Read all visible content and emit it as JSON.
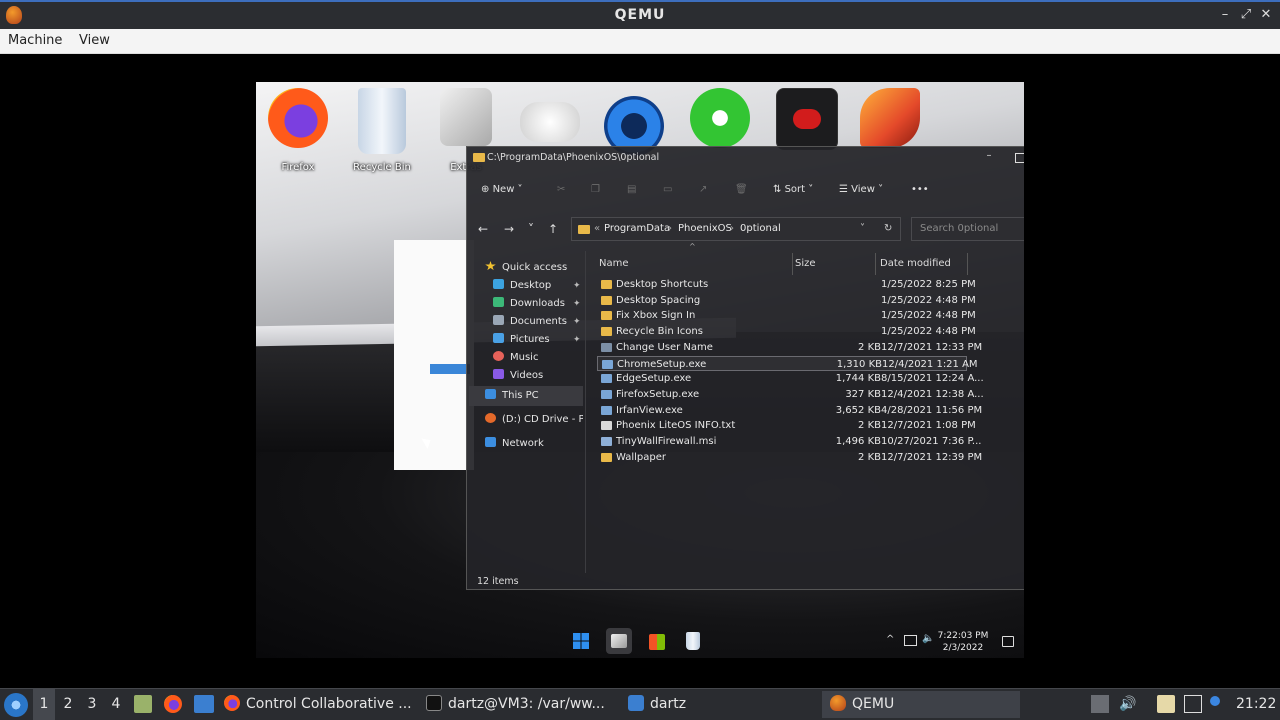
{
  "qemu": {
    "title": "QEMU",
    "menu": [
      "Machine",
      "View"
    ],
    "controls": {
      "minimize": "–",
      "restore": "⤢",
      "close": "✕"
    }
  },
  "desktop_icons": [
    {
      "label": "Firefox",
      "icon": "firefox-icon",
      "color": "#ff7a1a"
    },
    {
      "label": "Recycle Bin",
      "icon": "recycle-bin-icon",
      "color": "#9db7d6"
    },
    {
      "label": "Extras",
      "icon": "folder-stack-icon",
      "color": "#c9c9c9"
    },
    {
      "label": "",
      "icon": "gamepad-icon",
      "color": "#e9e9e9"
    },
    {
      "label": "",
      "icon": "power-ring-icon",
      "color": "#1f6fd1"
    },
    {
      "label": "",
      "icon": "xbox-icon",
      "color": "#2fbf2f"
    },
    {
      "label": "",
      "icon": "youtube-icon",
      "color": "#d21c1c"
    },
    {
      "label": "",
      "icon": "phoenix-icon",
      "color": "#e4492a"
    }
  ],
  "explorer": {
    "title": "C:\\ProgramData\\PhoenixOS\\0ptional",
    "toolbar": {
      "new": "New",
      "sort": "Sort",
      "view": "View",
      "more": "•••"
    },
    "breadcrumb": [
      "ProgramData",
      "PhoenixOS",
      "0ptional"
    ],
    "search_placeholder": "Search 0ptional",
    "nav": {
      "quick_access": "Quick access",
      "desktop": "Desktop",
      "downloads": "Downloads",
      "documents": "Documents",
      "pictures": "Pictures",
      "music": "Music",
      "videos": "Videos",
      "this_pc": "This PC",
      "cd_drive": "(D:) CD Drive - Phoenix",
      "network": "Network"
    },
    "columns": {
      "name": "Name",
      "size": "Size",
      "date": "Date modified"
    },
    "files": [
      {
        "name": "Desktop Shortcuts",
        "size": "",
        "date": "1/25/2022 8:25 PM",
        "type": "folder"
      },
      {
        "name": "Desktop Spacing",
        "size": "",
        "date": "1/25/2022 4:48 PM",
        "type": "folder"
      },
      {
        "name": "Fix Xbox Sign In",
        "size": "",
        "date": "1/25/2022 4:48 PM",
        "type": "folder"
      },
      {
        "name": "Recycle Bin Icons",
        "size": "",
        "date": "1/25/2022 4:48 PM",
        "type": "folder"
      },
      {
        "name": "Change User Name",
        "size": "2 KB",
        "date": "12/7/2021 12:33 PM",
        "type": "shortcut"
      },
      {
        "name": "ChromeSetup.exe",
        "size": "1,310 KB",
        "date": "12/4/2021 1:21 AM",
        "type": "exe"
      },
      {
        "name": "EdgeSetup.exe",
        "size": "1,744 KB",
        "date": "8/15/2021 12:24 A...",
        "type": "exe"
      },
      {
        "name": "FirefoxSetup.exe",
        "size": "327 KB",
        "date": "12/4/2021 12:38 A...",
        "type": "exe"
      },
      {
        "name": "IrfanView.exe",
        "size": "3,652 KB",
        "date": "4/28/2021 11:56 PM",
        "type": "exe"
      },
      {
        "name": "Phoenix LiteOS INFO.txt",
        "size": "2 KB",
        "date": "12/7/2021 1:08 PM",
        "type": "txt"
      },
      {
        "name": "TinyWallFirewall.msi",
        "size": "1,496 KB",
        "date": "10/27/2021 7:36 P...",
        "type": "msi"
      },
      {
        "name": "Wallpaper",
        "size": "2 KB",
        "date": "12/7/2021 12:39 PM",
        "type": "folder"
      }
    ],
    "status": "12 items",
    "selected_row": 5
  },
  "guest_taskbar": {
    "time": "7:22:03 PM",
    "date": "2/3/2022"
  },
  "host_taskbar": {
    "workspaces": [
      "1",
      "2",
      "3",
      "4"
    ],
    "active_workspace": "1",
    "tasks": [
      {
        "label": "Control Collaborative ...",
        "icon": "firefox-icon"
      },
      {
        "label": "dartz@VM3: /var/ww...",
        "icon": "terminal-icon"
      },
      {
        "label": "dartz",
        "icon": "folder-icon"
      },
      {
        "label": "QEMU",
        "icon": "qemu-icon"
      }
    ],
    "clock": "21:22"
  },
  "colors": {
    "accent": "#3d6ebd",
    "folder": "#e9b949",
    "selection": "#6a6a70"
  }
}
